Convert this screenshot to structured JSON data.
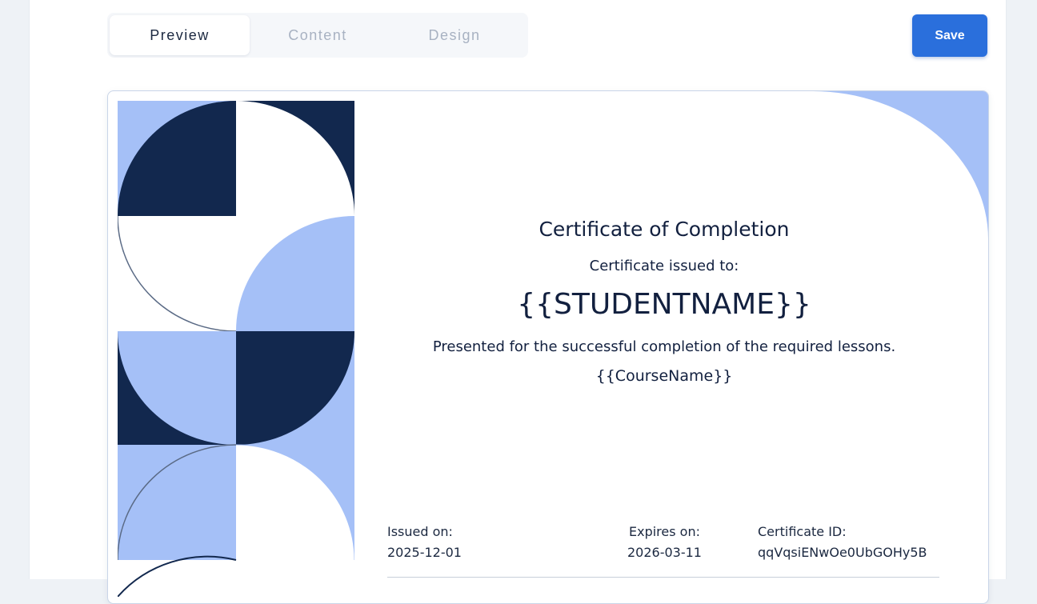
{
  "tabs": [
    {
      "label": "Preview",
      "active": true
    },
    {
      "label": "Content",
      "active": false
    },
    {
      "label": "Design",
      "active": false
    }
  ],
  "toolbar": {
    "save_label": "Save"
  },
  "certificate": {
    "title": "Certificate of Completion",
    "issued_to_label": "Certificate issued to:",
    "student_name": "{{STUDENTNAME}}",
    "presented_text": "Presented for the successful completion of the required lessons.",
    "course_name": "{{CourseName}}",
    "issued_on_label": "Issued on:",
    "issued_on_value": "2025-12-01",
    "expires_on_label": "Expires on:",
    "expires_on_value": "2026-03-11",
    "certificate_id_label": "Certificate ID:",
    "certificate_id_value": "qqVqsiENwOe0UbGOHy5B"
  },
  "colors": {
    "accent": "#2a6fdc",
    "navy": "#12284e",
    "light_blue": "#a5c0f7",
    "text_dark": "#12203f"
  }
}
